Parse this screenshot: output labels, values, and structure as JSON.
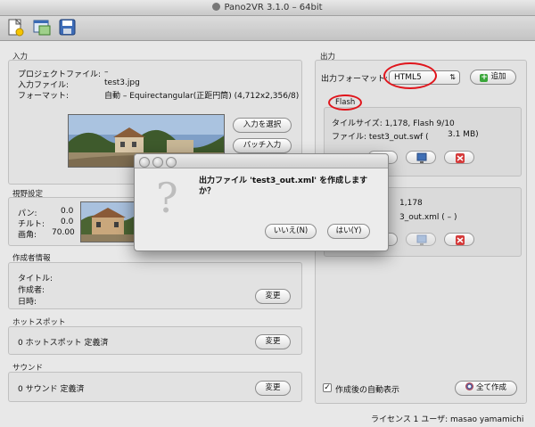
{
  "window": {
    "title": "Pano2VR 3.1.0 – 64bit"
  },
  "toolbar": {
    "icons": [
      "new-project-icon",
      "open-window-icon",
      "save-icon"
    ]
  },
  "input": {
    "section_label": "入力",
    "project_file_label": "プロジェクトファイル:",
    "project_file_value": "–",
    "input_file_label": "入力ファイル:",
    "input_file_value": "test3.jpg",
    "format_label": "フォーマット:",
    "format_value": "自動 – Equirectangular(正距円筒) (4,712x2,356/8)",
    "select_input_button": "入力を選択",
    "patch_input_button": "パッチ入力"
  },
  "view": {
    "section_label": "視野設定",
    "pan_label": "パン:",
    "pan_value": "0.0",
    "tilt_label": "チルト:",
    "tilt_value": "0.0",
    "fov_label": "画角:",
    "fov_value": "70.00"
  },
  "author": {
    "section_label": "作成者情報",
    "title_label": "タイトル:",
    "author_label": "作成者:",
    "date_label": "日時:",
    "change_button": "変更"
  },
  "hotspot": {
    "section_label": "ホットスポット",
    "summary": "0 ホットスポット 定義済",
    "change_button": "変更"
  },
  "sound": {
    "section_label": "サウンド",
    "summary": "0 サウンド 定義済",
    "change_button": "変更"
  },
  "output": {
    "section_label": "出力",
    "format_label": "出力フォーマット:",
    "format_selected": "HTML5",
    "add_button": "追加",
    "flash": {
      "title": "Flash",
      "tile_size": "タイルサイズ: 1,178, Flash 9/10",
      "file": "ファイル: test3_out.swf (",
      "size": "3.1 MB)"
    },
    "html5": {
      "tile_size": "1,178",
      "file": "3_out.xml ( – )"
    },
    "auto_display_label": "作成後の自動表示",
    "auto_display_checked": true,
    "create_all_button": "全て作成"
  },
  "status": {
    "license": "ライセンス 1 ユーザ: masao yamamichi"
  },
  "dialog": {
    "message_line1": "出力ファイル 'test3_out.xml' を作成しますか？",
    "message_line2": "か？",
    "no_button": "いいえ(N)",
    "yes_button": "はい(Y)"
  },
  "colors": {
    "annotation_red": "#e0151c",
    "add_green": "#3aa63a",
    "delete_red": "#d53a3a",
    "preview_blue": "#3f6fb5"
  }
}
